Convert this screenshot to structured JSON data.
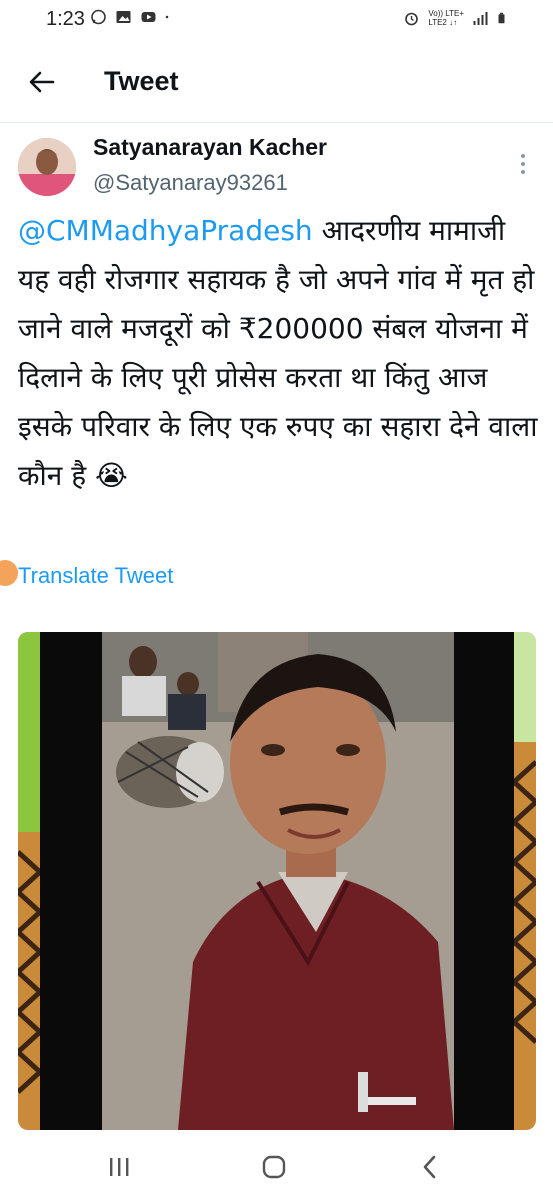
{
  "status_bar": {
    "time": "1:23",
    "left_icons": [
      "whatsapp-icon",
      "gallery-icon",
      "youtube-icon",
      "dot-icon"
    ],
    "right_icons": [
      "alarm-icon",
      "volte-label",
      "signal-icon",
      "battery-icon"
    ],
    "network_label_line1": "Vo)) LTE+",
    "network_label_line2": "LTE2 ↓↑"
  },
  "header": {
    "title": "Tweet",
    "back_icon": "arrow-left-icon"
  },
  "tweet": {
    "author_name": "Satyanarayan Kacher",
    "author_handle": "@Satyanaray93261",
    "mention": "@CMMadhyaPradesh",
    "body": "  आदरणीय मामाजी यह वही रोजगार सहायक है जो अपने गांव में मृत हो जाने वाले मजदूरों को ₹200000 संबल योजना में दिलाने के लिए पूरी प्रोसेस करता था किंतु आज इसके परिवार के लिए एक रुपए का सहारा देने वाला कौन है 😭",
    "translate_label": "Translate Tweet",
    "more_icon": "more-vertical-icon",
    "media_icon": "photo"
  },
  "nav": {
    "recent_icon": "recent-apps-icon",
    "home_icon": "home-icon",
    "back_icon": "nav-back-icon"
  },
  "colors": {
    "link": "#1d9bf0",
    "handle": "#536471",
    "text": "#0f1419"
  }
}
